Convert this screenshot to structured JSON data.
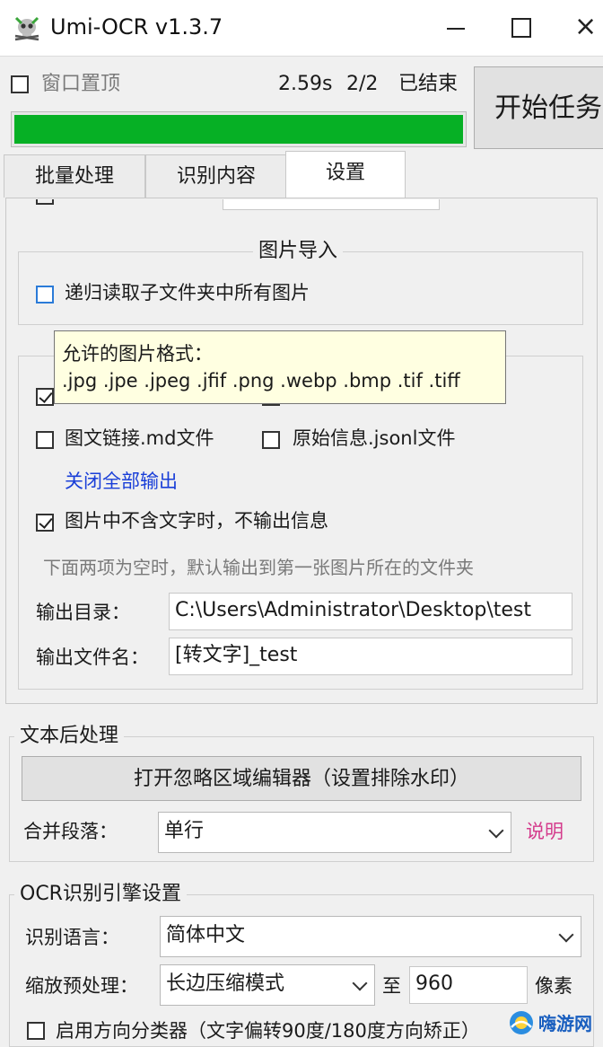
{
  "window": {
    "title": "Umi-OCR v1.3.7",
    "close_glyph": "×"
  },
  "topbar": {
    "pin_label": "窗口置顶",
    "elapsed": "2.59s",
    "progress_text": "2/2",
    "status": "已结束",
    "progress": 1.0,
    "start_label": "开始任务"
  },
  "tabs": [
    {
      "label": "批量处理",
      "active": false
    },
    {
      "label": "识别内容",
      "active": false
    },
    {
      "label": "设置",
      "active": true
    }
  ],
  "image_import": {
    "title": "图片导入",
    "recursive_label": "递归读取子文件夹中所有图片"
  },
  "tooltip": {
    "line1": "允许的图片格式：",
    "line2": ".jpg .jpe .jpeg .jfif .png .webp .bmp .tif .tiff"
  },
  "output": {
    "md_label": "图文链接.md文件",
    "jsonl_label": "原始信息.jsonl文件",
    "close_all_link": "关闭全部输出",
    "no_text_label": "图片中不含文字时，不输出信息",
    "hint": "下面两项为空时，默认输出到第一张图片所在的文件夹",
    "dir_label": "输出目录：",
    "dir_value": "C:\\Users\\Administrator\\Desktop\\test",
    "name_label": "输出文件名：",
    "name_value": "[转文字]_test"
  },
  "post": {
    "title": "文本后处理",
    "ignore_button": "打开忽略区域编辑器（设置排除水印）",
    "merge_label": "合并段落：",
    "merge_value": "单行",
    "help_link": "说明"
  },
  "engine": {
    "title": "OCR识别引擎设置",
    "lang_label": "识别语言：",
    "lang_value": "简体中文",
    "scale_label": "缩放预处理：",
    "scale_value": "长边压缩模式",
    "to_label": "至",
    "scale_number": "960",
    "unit": "像素",
    "direction_label": "启用方向分类器（文字偏转90度/180度方向矫正）"
  },
  "watermark": {
    "text": "嗨游网"
  },
  "colors": {
    "progress": "#06b025",
    "link": "#1a3fd8",
    "help": "#d43b8c",
    "tooltip_bg": "#ffffe1"
  }
}
